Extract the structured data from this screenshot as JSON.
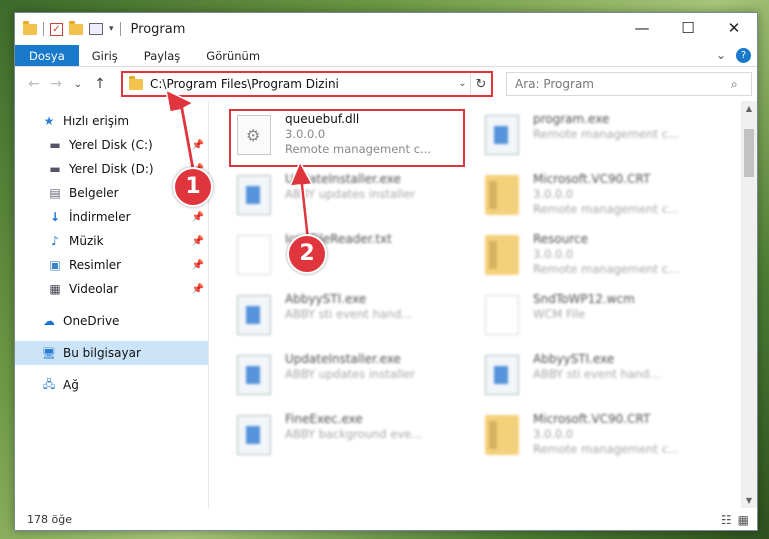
{
  "window": {
    "title": "Program"
  },
  "controls": {
    "minimize": "—",
    "maximize": "☐",
    "close": "✕"
  },
  "ribbon": {
    "tabs": [
      "Dosya",
      "Giriş",
      "Paylaş",
      "Görünüm"
    ],
    "expand": "⌄",
    "help": "?"
  },
  "nav": {
    "back": "←",
    "forward": "→",
    "recent": "⌄",
    "up": "↑"
  },
  "address": {
    "path": "C:\\Program Files\\Program Dizini",
    "dropdown": "⌄",
    "refresh": "↻"
  },
  "search": {
    "placeholder": "Ara: Program",
    "icon": "⌕"
  },
  "sidebar": {
    "quick_access": "Hızlı erişim",
    "items": [
      {
        "label": "Yerel Disk (C:)",
        "icon": "drive-icon",
        "glyph": "▬"
      },
      {
        "label": "Yerel Disk (D:)",
        "icon": "drive-icon",
        "glyph": "▬"
      },
      {
        "label": "Belgeler",
        "icon": "documents-icon",
        "glyph": "▤"
      },
      {
        "label": "İndirmeler",
        "icon": "downloads-icon",
        "glyph": "↓"
      },
      {
        "label": "Müzik",
        "icon": "music-icon",
        "glyph": "♪"
      },
      {
        "label": "Resimler",
        "icon": "pictures-icon",
        "glyph": "▣"
      },
      {
        "label": "Videolar",
        "icon": "videos-icon",
        "glyph": "▦"
      }
    ],
    "onedrive": "OneDrive",
    "this_pc": "Bu bilgisayar",
    "network": "Ağ",
    "pin": "📌",
    "star": "★",
    "cloud": "☁",
    "pc": "🖥",
    "net": "🖧"
  },
  "files": [
    {
      "name": "queuebuf.dll",
      "sub1": "3.0.0.0",
      "sub2": "Remote management c...",
      "type": "dll"
    },
    {
      "name": "program.exe",
      "sub1": "Remote management c...",
      "sub2": "",
      "type": "exe"
    },
    {
      "name": "UpdateInstaller.exe",
      "sub1": "ABBY updates installer",
      "sub2": "",
      "type": "exe"
    },
    {
      "name": "Microsoft.VC90.CRT",
      "sub1": "3.0.0.0",
      "sub2": "Remote management c...",
      "type": "fold"
    },
    {
      "name": "IconFileReader.txt",
      "sub1": "",
      "sub2": "",
      "type": "txt"
    },
    {
      "name": "Resource",
      "sub1": "3.0.0.0",
      "sub2": "Remote management c...",
      "type": "fold"
    },
    {
      "name": "AbbyySTI.exe",
      "sub1": "ABBY sti event hand...",
      "sub2": "",
      "type": "exe"
    },
    {
      "name": "SndToWP12.wcm",
      "sub1": "WCM File",
      "sub2": "",
      "type": "txt"
    },
    {
      "name": "UpdateInstaller.exe",
      "sub1": "ABBY updates installer",
      "sub2": "",
      "type": "exe"
    },
    {
      "name": "AbbyySTI.exe",
      "sub1": "ABBY sti event hand...",
      "sub2": "",
      "type": "exe"
    },
    {
      "name": "FineExec.exe",
      "sub1": "ABBY background eve...",
      "sub2": "",
      "type": "exe"
    },
    {
      "name": "Microsoft.VC90.CRT",
      "sub1": "3.0.0.0",
      "sub2": "Remote management c...",
      "type": "fold"
    }
  ],
  "status": {
    "count": "178 öğe",
    "details_view": "☷",
    "tiles_view": "▦"
  },
  "annotations": {
    "one": "1",
    "two": "2",
    "color": "#e0353c"
  }
}
